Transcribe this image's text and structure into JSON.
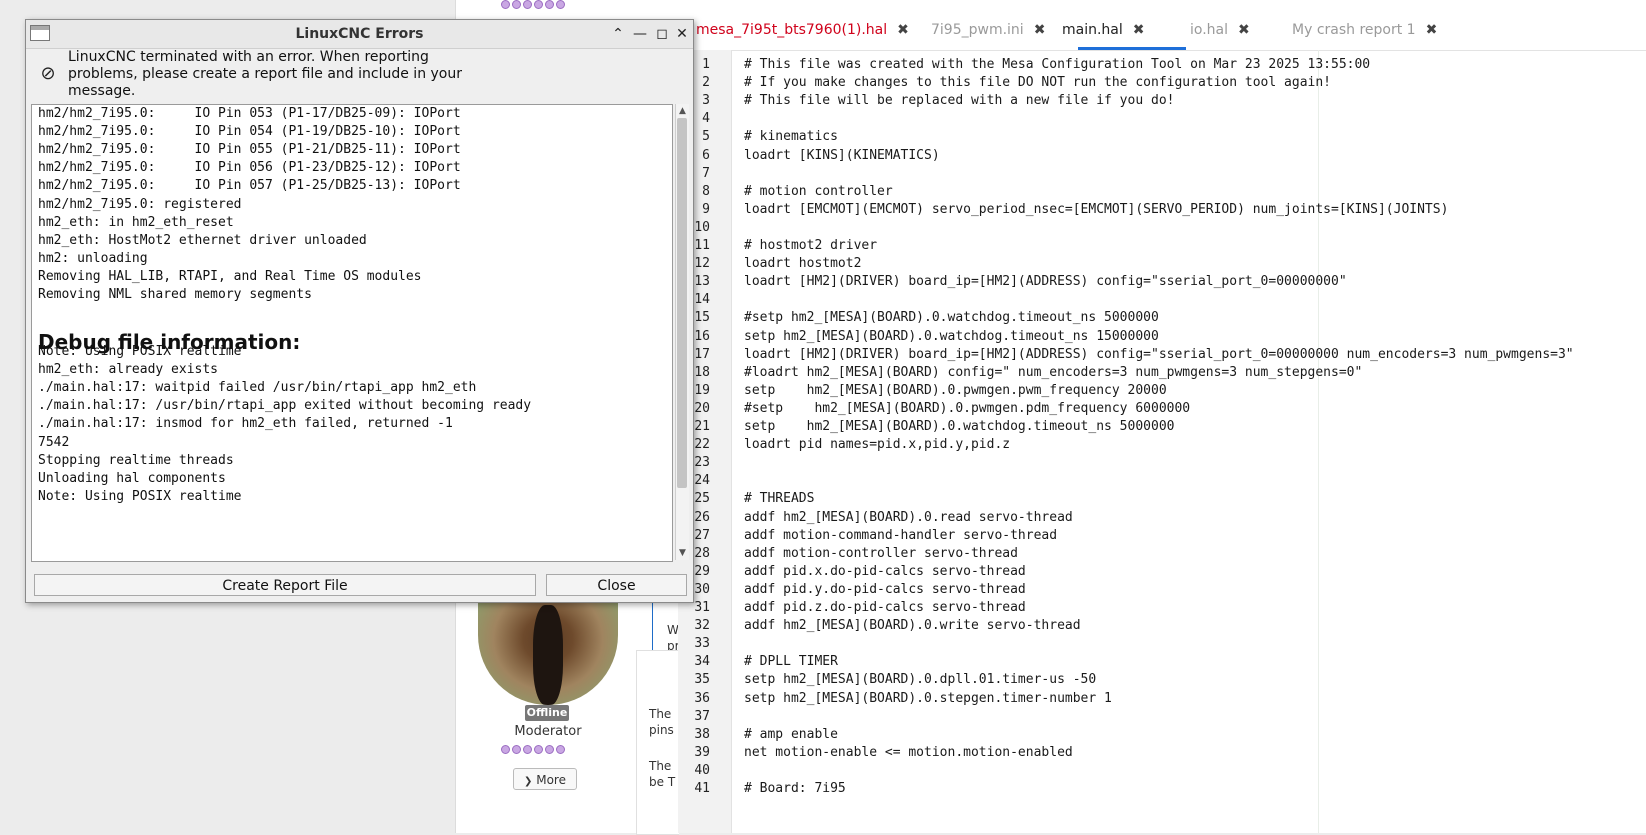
{
  "forum": {
    "status_badge": "Offline",
    "role": "Moderator",
    "more_label": "More",
    "post_fragments": [
      "W",
      "pr",
      "The",
      "pins",
      "The",
      "be T"
    ]
  },
  "editor": {
    "tabs": [
      {
        "label": "mesa_7i95t_bts7960(1).hal",
        "color": "#d0021b"
      },
      {
        "label": "7i95_pwm.ini",
        "color": "#9a9a9a"
      },
      {
        "label": "main.hal",
        "color": "#222222"
      },
      {
        "label": "io.hal",
        "color": "#9a9a9a"
      },
      {
        "label": "My crash report 1",
        "color": "#9a9a9a"
      }
    ],
    "active_tab_accent": "#1e6fd9",
    "lines": [
      "# This file was created with the Mesa Configuration Tool on Mar 23 2025 13:55:00",
      "# If you make changes to this file DO NOT run the configuration tool again!",
      "# This file will be replaced with a new file if you do!",
      "",
      "# kinematics",
      "loadrt [KINS](KINEMATICS)",
      "",
      "# motion controller",
      "loadrt [EMCMOT](EMCMOT) servo_period_nsec=[EMCMOT](SERVO_PERIOD) num_joints=[KINS](JOINTS)",
      "",
      "# hostmot2 driver",
      "loadrt hostmot2",
      "loadrt [HM2](DRIVER) board_ip=[HM2](ADDRESS) config=\"sserial_port_0=00000000\"",
      "",
      "#setp hm2_[MESA](BOARD).0.watchdog.timeout_ns 5000000",
      "setp hm2_[MESA](BOARD).0.watchdog.timeout_ns 15000000",
      "loadrt [HM2](DRIVER) board_ip=[HM2](ADDRESS) config=\"sserial_port_0=00000000 num_encoders=3 num_pwmgens=3\"",
      "#loadrt hm2_[MESA](BOARD) config=\" num_encoders=3 num_pwmgens=3 num_stepgens=0\"",
      "setp    hm2_[MESA](BOARD).0.pwmgen.pwm_frequency 20000",
      "#setp    hm2_[MESA](BOARD).0.pwmgen.pdm_frequency 6000000",
      "setp    hm2_[MESA](BOARD).0.watchdog.timeout_ns 5000000",
      "loadrt pid names=pid.x,pid.y,pid.z",
      "",
      "",
      "# THREADS",
      "addf hm2_[MESA](BOARD).0.read servo-thread",
      "addf motion-command-handler servo-thread",
      "addf motion-controller servo-thread",
      "addf pid.x.do-pid-calcs servo-thread",
      "addf pid.y.do-pid-calcs servo-thread",
      "addf pid.z.do-pid-calcs servo-thread",
      "addf hm2_[MESA](BOARD).0.write servo-thread",
      "",
      "# DPLL TIMER",
      "setp hm2_[MESA](BOARD).0.dpll.01.timer-us -50",
      "setp hm2_[MESA](BOARD).0.stepgen.timer-number 1",
      "",
      "# amp enable",
      "net motion-enable <= motion.motion-enabled",
      "",
      "# Board: 7i95"
    ]
  },
  "dialog": {
    "title": "LinuxCNC Errors",
    "message": "LinuxCNC terminated with an error.  When reporting problems, please create a report file and include in your message.",
    "log_lines_top": [
      "hm2/hm2_7i95.0:     IO Pin 053 (P1-17/DB25-09): IOPort",
      "hm2/hm2_7i95.0:     IO Pin 054 (P1-19/DB25-10): IOPort",
      "hm2/hm2_7i95.0:     IO Pin 055 (P1-21/DB25-11): IOPort",
      "hm2/hm2_7i95.0:     IO Pin 056 (P1-23/DB25-12): IOPort",
      "hm2/hm2_7i95.0:     IO Pin 057 (P1-25/DB25-13): IOPort",
      "hm2/hm2_7i95.0: registered",
      "hm2_eth: in hm2_eth_reset",
      "hm2_eth: HostMot2 ethernet driver unloaded",
      "hm2: unloading",
      "Removing HAL_LIB, RTAPI, and Real Time OS modules",
      "Removing NML shared memory segments"
    ],
    "debug_heading": "Debug file information:",
    "log_lines_bottom": [
      "Note: Using POSIX realtime",
      "hm2_eth: already exists",
      "./main.hal:17: waitpid failed /usr/bin/rtapi_app hm2_eth",
      "./main.hal:17: /usr/bin/rtapi_app exited without becoming ready",
      "./main.hal:17: insmod for hm2_eth failed, returned -1",
      "7542",
      "Stopping realtime threads",
      "Unloading hal components",
      "Note: Using POSIX realtime"
    ],
    "create_report_label": "Create Report File",
    "close_label": "Close"
  }
}
